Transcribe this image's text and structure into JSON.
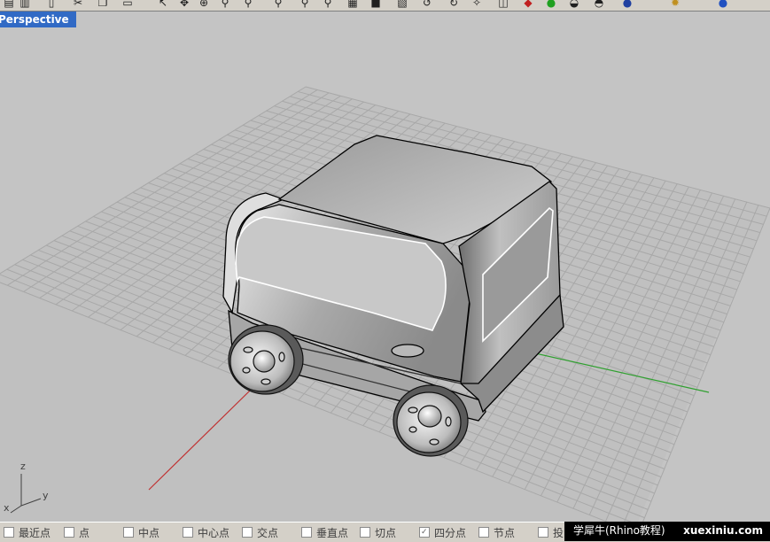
{
  "viewport": {
    "title": "Perspective"
  },
  "toolbar": {
    "icons": [
      "new-file-icon",
      "save-icon",
      "new-doc-icon",
      "cut-icon",
      "copy-icon",
      "paste-icon",
      "select-icon",
      "pan-icon",
      "rotate-view-icon",
      "zoom-icon",
      "zoom-window-icon",
      "zoom-extents-icon",
      "zoom-selected-icon",
      "zoom-target-icon",
      "grid-icon",
      "shaded-icon",
      "render-icon",
      "undo-icon",
      "redo-icon",
      "light-icon",
      "layer-icon",
      "color-icon",
      "material-icon",
      "sphere-icon",
      "sphere-render-icon",
      "options-icon",
      "gear-icon",
      "help-icon"
    ]
  },
  "axes": {
    "z": "z",
    "y": "y",
    "x": "x"
  },
  "osnap": [
    {
      "label": "最近点",
      "checked": false
    },
    {
      "label": "点",
      "checked": false
    },
    {
      "label": "中点",
      "checked": false
    },
    {
      "label": "中心点",
      "checked": false
    },
    {
      "label": "交点",
      "checked": false
    },
    {
      "label": "垂直点",
      "checked": false
    },
    {
      "label": "切点",
      "checked": false
    },
    {
      "label": "四分点",
      "checked": true
    },
    {
      "label": "节点",
      "checked": false
    },
    {
      "label": "投",
      "checked": false
    }
  ],
  "watermark": {
    "left": "学犀牛(Rhino教程)",
    "right": "xuexiniu.com"
  },
  "colors": {
    "title_bg": "#316ac5",
    "x_axis": "#c03030",
    "y_axis": "#30a030",
    "grid": "#a8a8a8"
  }
}
